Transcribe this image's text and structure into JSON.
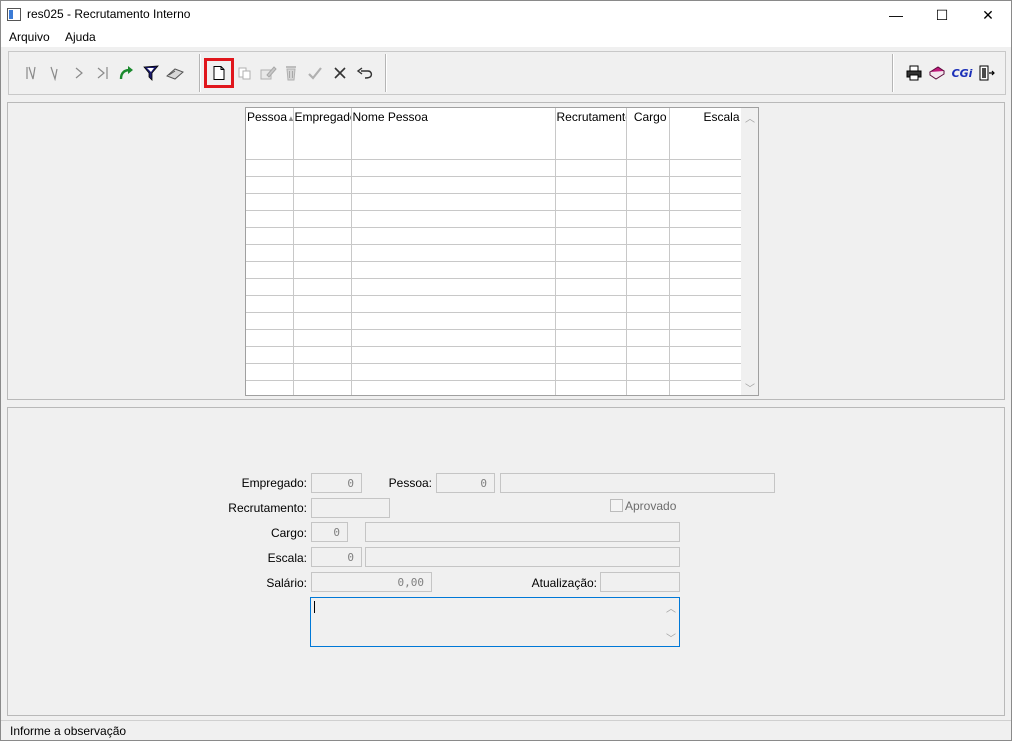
{
  "window": {
    "title": "res025 - Recrutamento Interno",
    "minimize_glyph": "—",
    "maximize_glyph": "☐",
    "close_glyph": "✕"
  },
  "menu": {
    "items": [
      "Arquivo",
      "Ajuda"
    ]
  },
  "toolbar": {
    "nav_buttons": [
      "first-record-icon",
      "previous-record-icon",
      "next-record-icon",
      "last-record-icon",
      "refresh-icon",
      "filter-icon",
      "clear-filter-icon"
    ],
    "edit_buttons": [
      "new-record-icon",
      "copy-record-icon",
      "edit-record-icon",
      "delete-record-icon",
      "confirm-icon",
      "cancel-icon",
      "undo-icon"
    ],
    "right_buttons": [
      "print-icon",
      "help-book-icon",
      "cgi-icon",
      "exit-icon"
    ],
    "cgi_label": "CGi",
    "highlight_color": "#e0161c"
  },
  "grid": {
    "columns": [
      "Pessoa",
      "Empregado",
      "Nome Pessoa",
      "Recrutamento",
      "Cargo",
      "Escala"
    ],
    "sort_indicator": "▲",
    "scroll_up": "︿",
    "scroll_down": "﹀",
    "rows": [
      [
        "",
        "",
        "",
        "",
        "",
        ""
      ],
      [
        "",
        "",
        "",
        "",
        "",
        ""
      ],
      [
        "",
        "",
        "",
        "",
        "",
        ""
      ],
      [
        "",
        "",
        "",
        "",
        "",
        ""
      ],
      [
        "",
        "",
        "",
        "",
        "",
        ""
      ],
      [
        "",
        "",
        "",
        "",
        "",
        ""
      ],
      [
        "",
        "",
        "",
        "",
        "",
        ""
      ],
      [
        "",
        "",
        "",
        "",
        "",
        ""
      ],
      [
        "",
        "",
        "",
        "",
        "",
        ""
      ],
      [
        "",
        "",
        "",
        "",
        "",
        ""
      ],
      [
        "",
        "",
        "",
        "",
        "",
        ""
      ],
      [
        "",
        "",
        "",
        "",
        "",
        ""
      ],
      [
        "",
        "",
        "",
        "",
        "",
        ""
      ],
      [
        "",
        "",
        "",
        "",
        "",
        ""
      ],
      [
        "",
        "",
        "",
        "",
        "",
        ""
      ]
    ]
  },
  "form": {
    "empregado_label": "Empregado:",
    "empregado_value": "0",
    "pessoa_label": "Pessoa:",
    "pessoa_value": "0",
    "pessoa_name": "",
    "recrutamento_label": "Recrutamento:",
    "recrutamento_value": "",
    "aprovado_label": "Aprovado",
    "cargo_label": "Cargo:",
    "cargo_value": "0",
    "cargo_desc": "",
    "escala_label": "Escala:",
    "escala_value": "0",
    "escala_desc": "",
    "salario_label": "Salário:",
    "salario_value": "0,00",
    "atualizacao_label": "Atualização:",
    "atualizacao_value": "",
    "observacao": "",
    "memo_scroll_up": "︿",
    "memo_scroll_down": "﹀"
  },
  "status": {
    "text": "Informe a observação"
  }
}
